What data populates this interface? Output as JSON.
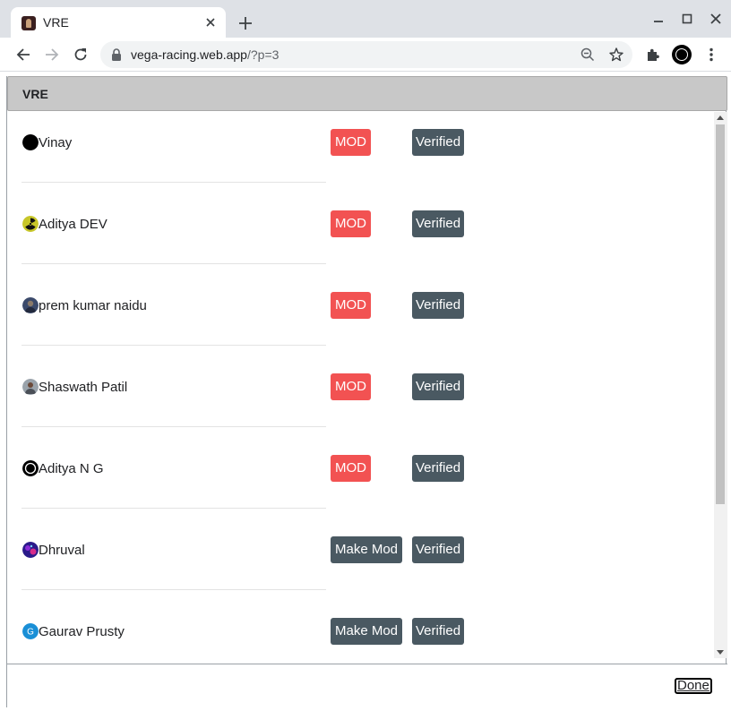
{
  "browser": {
    "tab_title": "VRE",
    "url_host": "vega-racing.web.app",
    "url_path": "/?p=3"
  },
  "dialog": {
    "title": "VRE",
    "done_label": "Done"
  },
  "members": [
    {
      "name": "Vinay",
      "mod_label": "MOD",
      "is_mod": true,
      "verified_label": "Verified",
      "avatar": "black-circle-avatar"
    },
    {
      "name": "Aditya DEV",
      "mod_label": "MOD",
      "is_mod": true,
      "verified_label": "Verified",
      "avatar": "radiation-avatar"
    },
    {
      "name": "prem kumar naidu",
      "mod_label": "MOD",
      "is_mod": true,
      "verified_label": "Verified",
      "avatar": "photo-avatar"
    },
    {
      "name": "Shaswath Patil",
      "mod_label": "MOD",
      "is_mod": true,
      "verified_label": "Verified",
      "avatar": "photo-avatar"
    },
    {
      "name": "Aditya N G",
      "mod_label": "MOD",
      "is_mod": true,
      "verified_label": "Verified",
      "avatar": "ring-avatar"
    },
    {
      "name": "Dhruval",
      "mod_label": "Make Mod",
      "is_mod": false,
      "verified_label": "Verified",
      "avatar": "galaxy-avatar"
    },
    {
      "name": "Gaurav Prusty",
      "mod_label": "Make Mod",
      "is_mod": false,
      "verified_label": "Verified",
      "avatar": "letter-avatar",
      "avatar_letter": "G"
    }
  ],
  "colors": {
    "mod_red": "#f25252",
    "slate_button": "#4a5962",
    "header_gray": "#c8c8c8"
  }
}
